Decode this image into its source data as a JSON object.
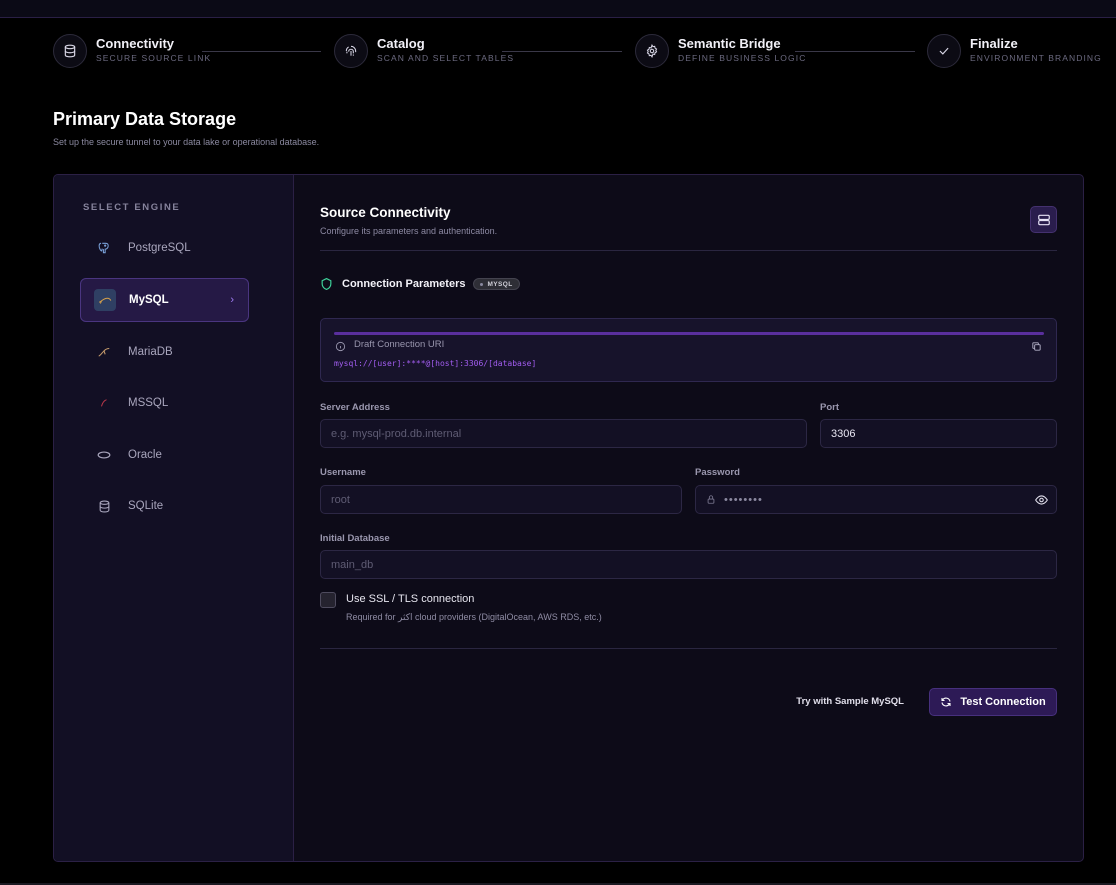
{
  "stepper": {
    "steps": [
      {
        "title": "Connectivity",
        "subtitle": "SECURE SOURCE LINK",
        "icon": "database-icon"
      },
      {
        "title": "Catalog",
        "subtitle": "SCAN AND SELECT TABLES",
        "icon": "fingerprint-icon"
      },
      {
        "title": "Semantic Bridge",
        "subtitle": "DEFINE BUSINESS LOGIC",
        "icon": "gear-icon"
      },
      {
        "title": "Finalize",
        "subtitle": "ENVIRONMENT BRANDING",
        "icon": "check-icon"
      }
    ]
  },
  "page": {
    "title": "Primary Data Storage",
    "subtitle": "Set up the secure tunnel to your data lake or operational database."
  },
  "sidebar": {
    "heading": "SELECT ENGINE",
    "engines": [
      {
        "label": "PostgreSQL",
        "icon": "elephant-icon",
        "active": false
      },
      {
        "label": "MySQL",
        "icon": "dolphin-icon",
        "active": true
      },
      {
        "label": "MariaDB",
        "icon": "seal-icon",
        "active": false
      },
      {
        "label": "MSSQL",
        "icon": "mssql-icon",
        "active": false
      },
      {
        "label": "Oracle",
        "icon": "oval-icon",
        "active": false
      },
      {
        "label": "SQLite",
        "icon": "database-icon",
        "active": false
      }
    ]
  },
  "source": {
    "title": "Source Connectivity",
    "subtitle": "Configure its parameters and authentication."
  },
  "connection": {
    "label": "Connection Parameters",
    "badge": "MYSQL"
  },
  "uri": {
    "label": "Draft Connection URI",
    "value": "mysql://[user]:****@[host]:3306/[database]"
  },
  "form": {
    "server_label": "Server Address",
    "server_placeholder": "e.g. mysql-prod.db.internal",
    "port_label": "Port",
    "port_value": "3306",
    "username_label": "Username",
    "username_placeholder": "root",
    "password_label": "Password",
    "password_value": "••••••••",
    "database_label": "Initial Database",
    "database_placeholder": "main_db",
    "ssl_label": "Use SSL / TLS connection",
    "ssl_sub": "Required for اکثر cloud providers (DigitalOcean, AWS RDS, etc.)"
  },
  "actions": {
    "sample_label": "Try with Sample MySQL",
    "test_label": "Test Connection"
  },
  "colors": {
    "accent": "#a25df0",
    "active_bg": "#251945",
    "button_bg": "#2d1a56",
    "shield_green": "#3ed19a"
  }
}
